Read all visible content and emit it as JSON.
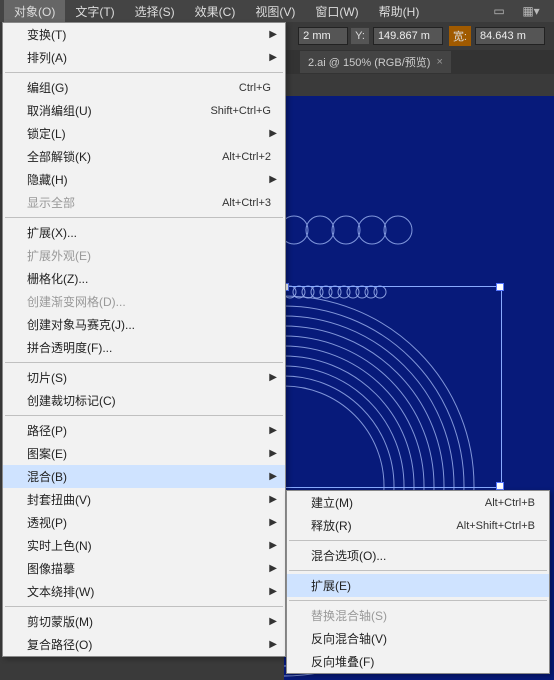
{
  "menubar": {
    "items": [
      {
        "label": "对象(O)",
        "active": true
      },
      {
        "label": "文字(T)"
      },
      {
        "label": "选择(S)"
      },
      {
        "label": "效果(C)"
      },
      {
        "label": "视图(V)"
      },
      {
        "label": "窗口(W)"
      },
      {
        "label": "帮助(H)"
      }
    ]
  },
  "toolbar": {
    "unit_label": "2 mm",
    "y_label": "Y:",
    "y_value": "149.867 m",
    "w_label": "宽:",
    "w_value": "84.643 m"
  },
  "tabbar": {
    "tab_label": "2.ai @ 150% (RGB/预览)",
    "close": "×"
  },
  "dropdown": [
    {
      "type": "item",
      "label": "变换(T)",
      "arrow": true
    },
    {
      "type": "item",
      "label": "排列(A)",
      "arrow": true
    },
    {
      "type": "sep"
    },
    {
      "type": "item",
      "label": "编组(G)",
      "shortcut": "Ctrl+G"
    },
    {
      "type": "item",
      "label": "取消编组(U)",
      "shortcut": "Shift+Ctrl+G"
    },
    {
      "type": "item",
      "label": "锁定(L)",
      "arrow": true
    },
    {
      "type": "item",
      "label": "全部解锁(K)",
      "shortcut": "Alt+Ctrl+2"
    },
    {
      "type": "item",
      "label": "隐藏(H)",
      "arrow": true
    },
    {
      "type": "item",
      "label": "显示全部",
      "shortcut": "Alt+Ctrl+3",
      "disabled": true
    },
    {
      "type": "sep"
    },
    {
      "type": "item",
      "label": "扩展(X)..."
    },
    {
      "type": "item",
      "label": "扩展外观(E)",
      "disabled": true
    },
    {
      "type": "item",
      "label": "栅格化(Z)..."
    },
    {
      "type": "item",
      "label": "创建渐变网格(D)...",
      "disabled": true
    },
    {
      "type": "item",
      "label": "创建对象马赛克(J)..."
    },
    {
      "type": "item",
      "label": "拼合透明度(F)..."
    },
    {
      "type": "sep"
    },
    {
      "type": "item",
      "label": "切片(S)",
      "arrow": true
    },
    {
      "type": "item",
      "label": "创建裁切标记(C)"
    },
    {
      "type": "sep"
    },
    {
      "type": "item",
      "label": "路径(P)",
      "arrow": true
    },
    {
      "type": "item",
      "label": "图案(E)",
      "arrow": true
    },
    {
      "type": "item",
      "label": "混合(B)",
      "arrow": true,
      "highlight": true
    },
    {
      "type": "item",
      "label": "封套扭曲(V)",
      "arrow": true
    },
    {
      "type": "item",
      "label": "透视(P)",
      "arrow": true
    },
    {
      "type": "item",
      "label": "实时上色(N)",
      "arrow": true
    },
    {
      "type": "item",
      "label": "图像描摹",
      "arrow": true
    },
    {
      "type": "item",
      "label": "文本绕排(W)",
      "arrow": true
    },
    {
      "type": "sep"
    },
    {
      "type": "item",
      "label": "剪切蒙版(M)",
      "arrow": true
    },
    {
      "type": "item",
      "label": "复合路径(O)",
      "arrow": true
    }
  ],
  "submenu": [
    {
      "type": "item",
      "label": "建立(M)",
      "shortcut": "Alt+Ctrl+B"
    },
    {
      "type": "item",
      "label": "释放(R)",
      "shortcut": "Alt+Shift+Ctrl+B"
    },
    {
      "type": "sep"
    },
    {
      "type": "item",
      "label": "混合选项(O)..."
    },
    {
      "type": "sep"
    },
    {
      "type": "item",
      "label": "扩展(E)",
      "highlight": true
    },
    {
      "type": "sep"
    },
    {
      "type": "item",
      "label": "替换混合轴(S)",
      "disabled": true
    },
    {
      "type": "item",
      "label": "反向混合轴(V)"
    },
    {
      "type": "item",
      "label": "反向堆叠(F)"
    }
  ]
}
